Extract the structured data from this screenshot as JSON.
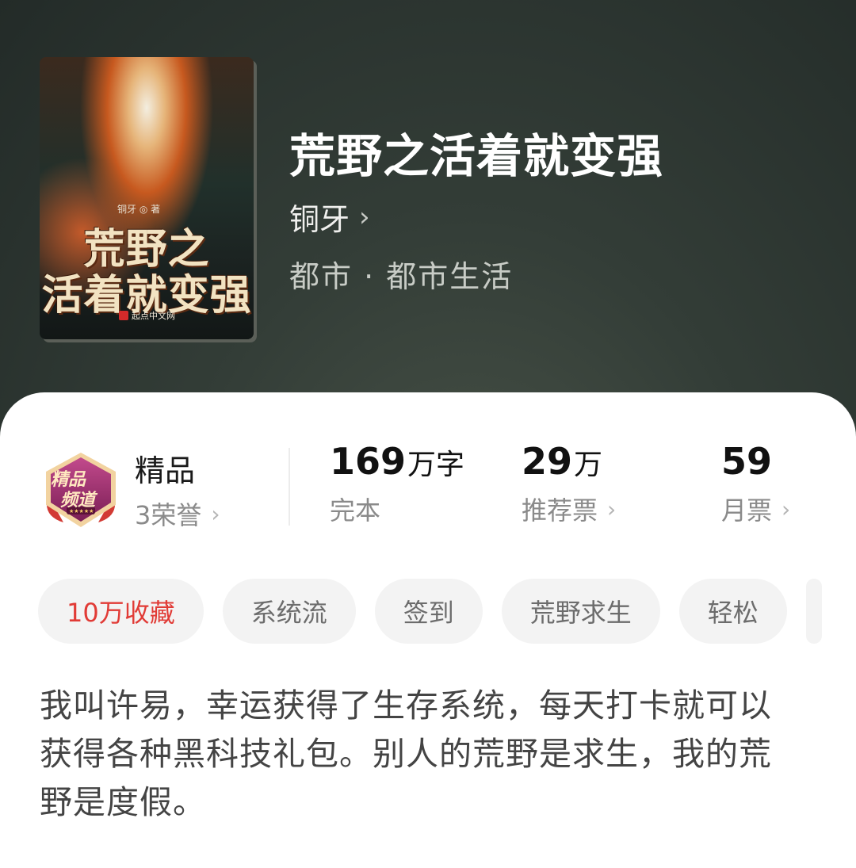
{
  "book": {
    "title": "荒野之活着就变强",
    "author": "铜牙",
    "genre": "都市 · 都市生活"
  },
  "cover": {
    "title_line1": "荒野之",
    "title_line2": "活着就变强",
    "author_credit": "铜牙 ◎ 著",
    "publisher": "起点中文网"
  },
  "badge": {
    "label": "精品",
    "honors": "3荣誉",
    "emblem_text_line1": "精品",
    "emblem_text_line2": "频道",
    "emblem_stars": "★★★★★"
  },
  "stats": [
    {
      "number": "169",
      "unit": "万字",
      "label": "完本"
    },
    {
      "number": "29",
      "unit": "万",
      "label": "推荐票"
    },
    {
      "number": "59",
      "unit": "",
      "label": "月票"
    }
  ],
  "tags": [
    "10万收藏",
    "系统流",
    "签到",
    "荒野求生",
    "轻松"
  ],
  "description": "我叫许易，幸运获得了生存系统，每天打卡就可以获得各种黑科技礼包。别人的荒野是求生，我的荒野是度假。",
  "colors": {
    "accent_red": "#e13b36",
    "hero_bg": "#333d37",
    "badge_purple": "#9b2d6c"
  }
}
